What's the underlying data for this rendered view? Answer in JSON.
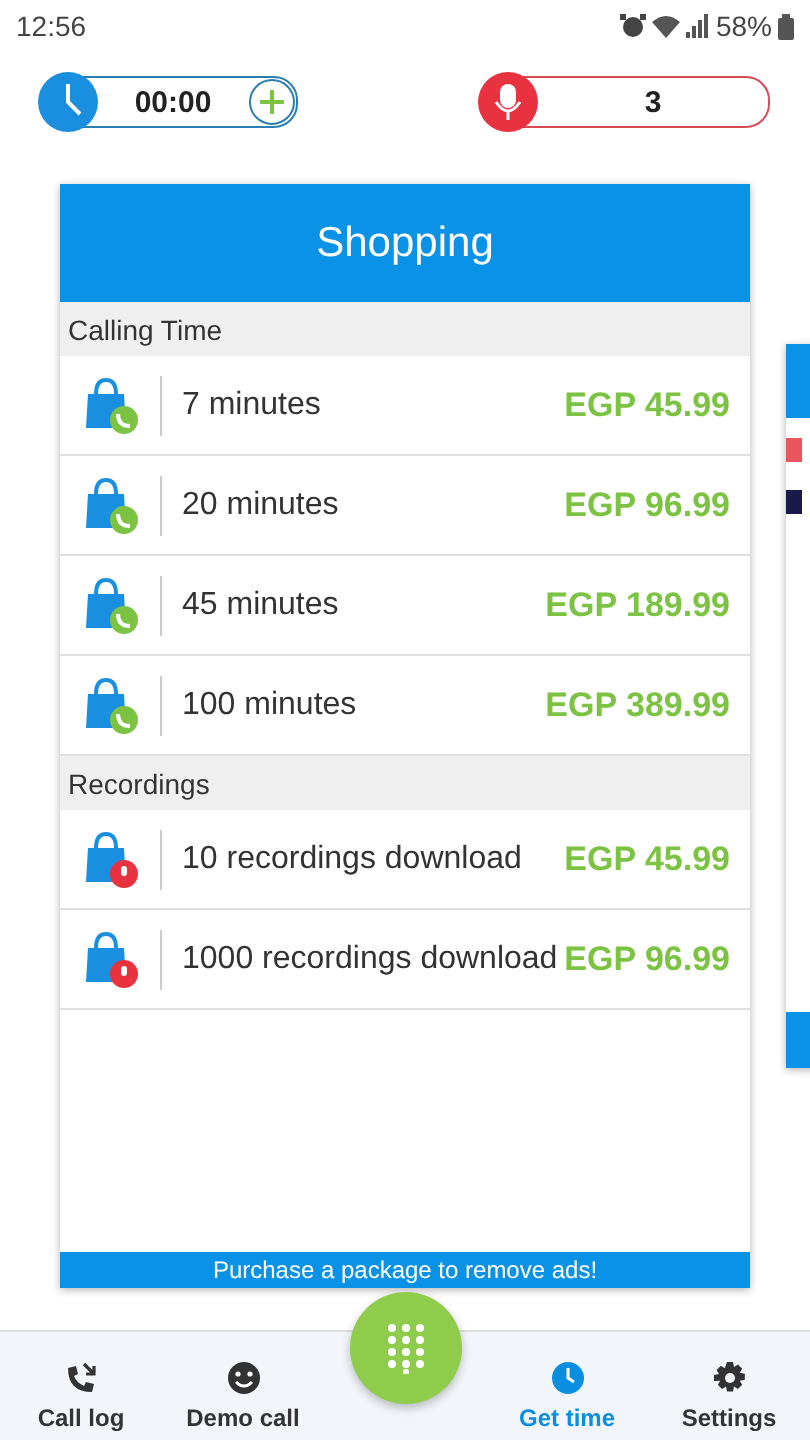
{
  "status_bar": {
    "time": "12:56",
    "battery": "58%"
  },
  "timer": {
    "value": "00:00"
  },
  "recordings_counter": {
    "value": "3"
  },
  "card": {
    "title": "Shopping",
    "sections": [
      {
        "title": "Calling Time",
        "items": [
          {
            "kind": "call",
            "label": "7 minutes",
            "price": "EGP 45.99"
          },
          {
            "kind": "call",
            "label": "20 minutes",
            "price": "EGP 96.99"
          },
          {
            "kind": "call",
            "label": "45 minutes",
            "price": "EGP 189.99"
          },
          {
            "kind": "call",
            "label": "100 minutes",
            "price": "EGP 389.99"
          }
        ]
      },
      {
        "title": "Recordings",
        "items": [
          {
            "kind": "recording",
            "label": "10 recordings download",
            "price": "EGP 45.99"
          },
          {
            "kind": "recording",
            "label": "1000 recordings download",
            "price": "EGP 96.99"
          }
        ]
      }
    ],
    "footer": "Purchase a package to remove ads!"
  },
  "bottom_nav": [
    {
      "kind": "calllog",
      "label": "Call log",
      "selected": false
    },
    {
      "kind": "demo",
      "label": "Demo call",
      "selected": false
    },
    {
      "kind": "dialpad",
      "selected": false
    },
    {
      "kind": "time",
      "label": "Get time",
      "selected": true
    },
    {
      "kind": "settings",
      "label": "Settings",
      "selected": false
    }
  ]
}
